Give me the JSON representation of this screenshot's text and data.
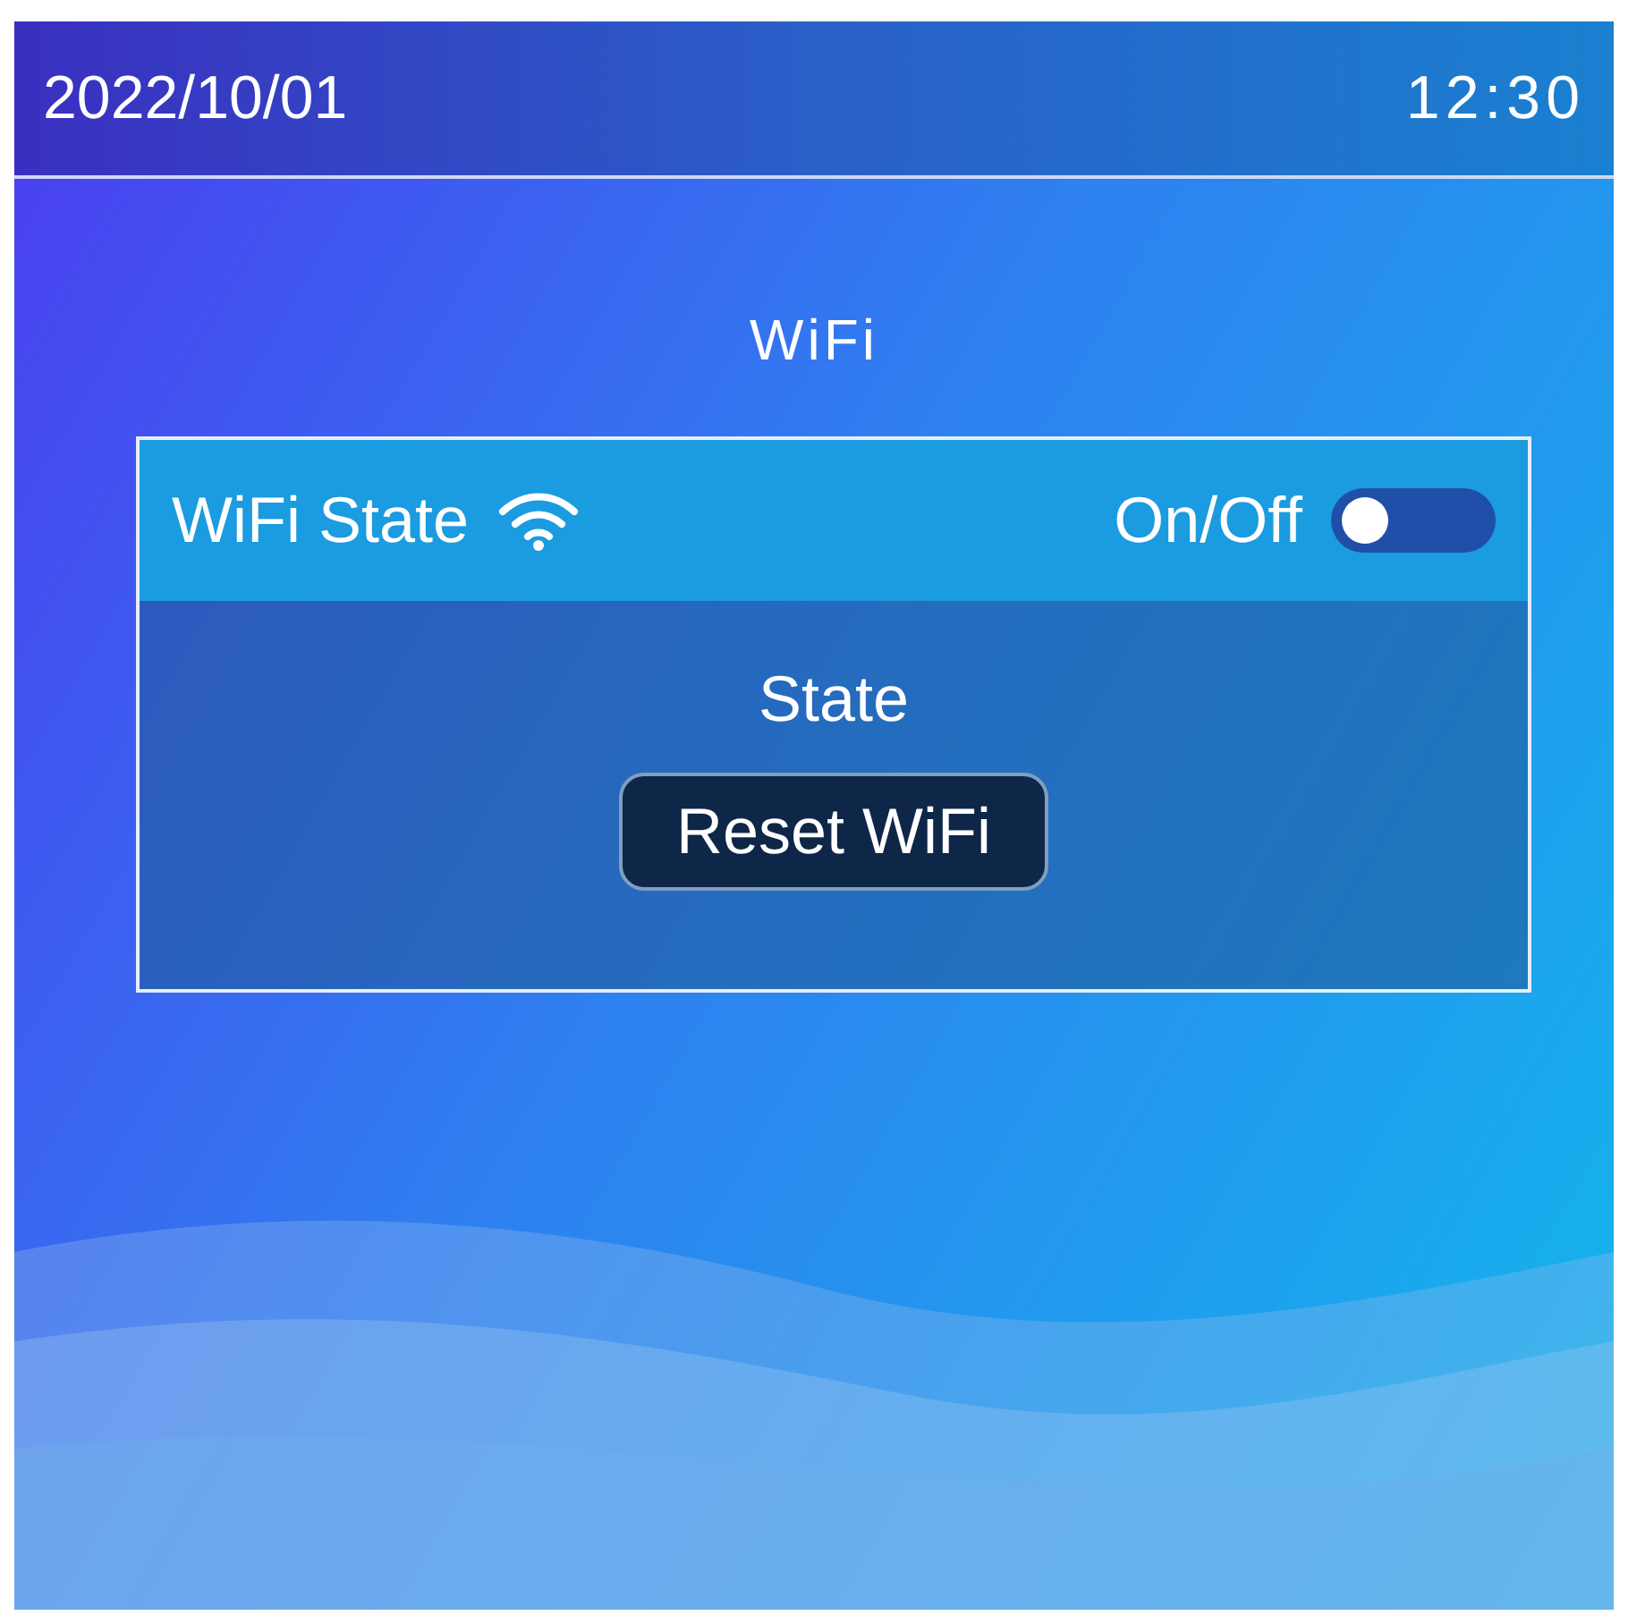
{
  "status_bar": {
    "date": "2022/10/01",
    "time": "12:30"
  },
  "title": "WiFi",
  "panel": {
    "label": "WiFi State",
    "toggle": {
      "label": "On/Off",
      "on": false
    },
    "state_label": "State",
    "button": "Reset WiFi"
  }
}
